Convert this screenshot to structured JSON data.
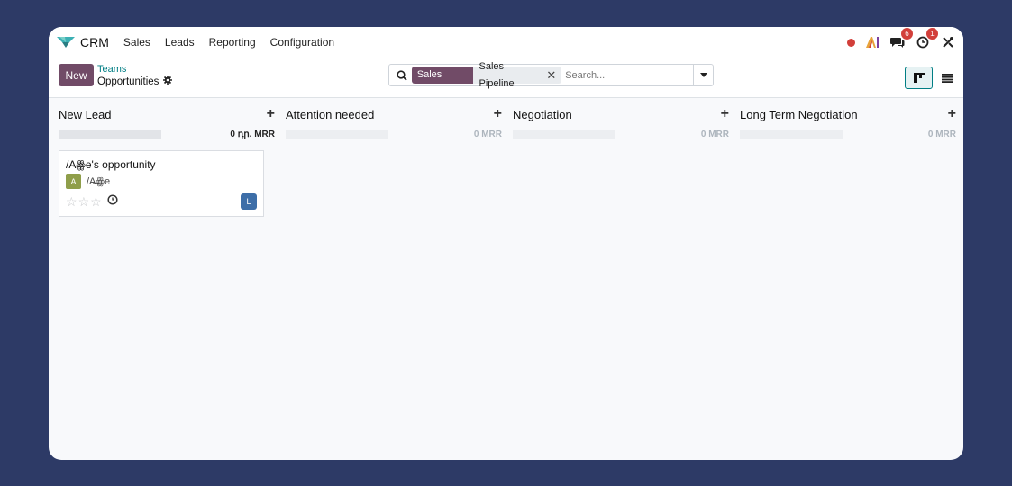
{
  "navbar": {
    "app_name": "CRM",
    "menu": [
      "Sales",
      "Leads",
      "Reporting",
      "Configuration"
    ],
    "messages_badge": "6",
    "activities_badge": "1"
  },
  "control_panel": {
    "new_label": "New",
    "breadcrumb_parent": "Teams",
    "breadcrumb_current": "Opportunities",
    "search": {
      "facet_label": "Sales Team",
      "facet_value": "Sales Pipeline",
      "placeholder": "Search..."
    }
  },
  "columns": [
    {
      "title": "New Lead",
      "total": "0 դր. MRR"
    },
    {
      "title": "Attention needed",
      "total": "0 MRR"
    },
    {
      "title": "Negotiation",
      "total": "0 MRR"
    },
    {
      "title": "Long Term Negotiation",
      "total": "0 MRR"
    }
  ],
  "card": {
    "title": "/A̶ꙮe's opportunity",
    "partner_initial": "A",
    "partner_name": "/A̶ꙮe",
    "salesperson_initial": "L",
    "stars": 0
  },
  "colors": {
    "brand": "#714b67",
    "accent": "#017e84",
    "background": "#2d3a66"
  },
  "icons": [
    "crm-logo-icon",
    "search-icon",
    "gear-icon",
    "caret-down-icon",
    "kanban-view-icon",
    "list-view-icon",
    "chat-icon",
    "clock-icon",
    "star-icon",
    "tools-icon"
  ]
}
